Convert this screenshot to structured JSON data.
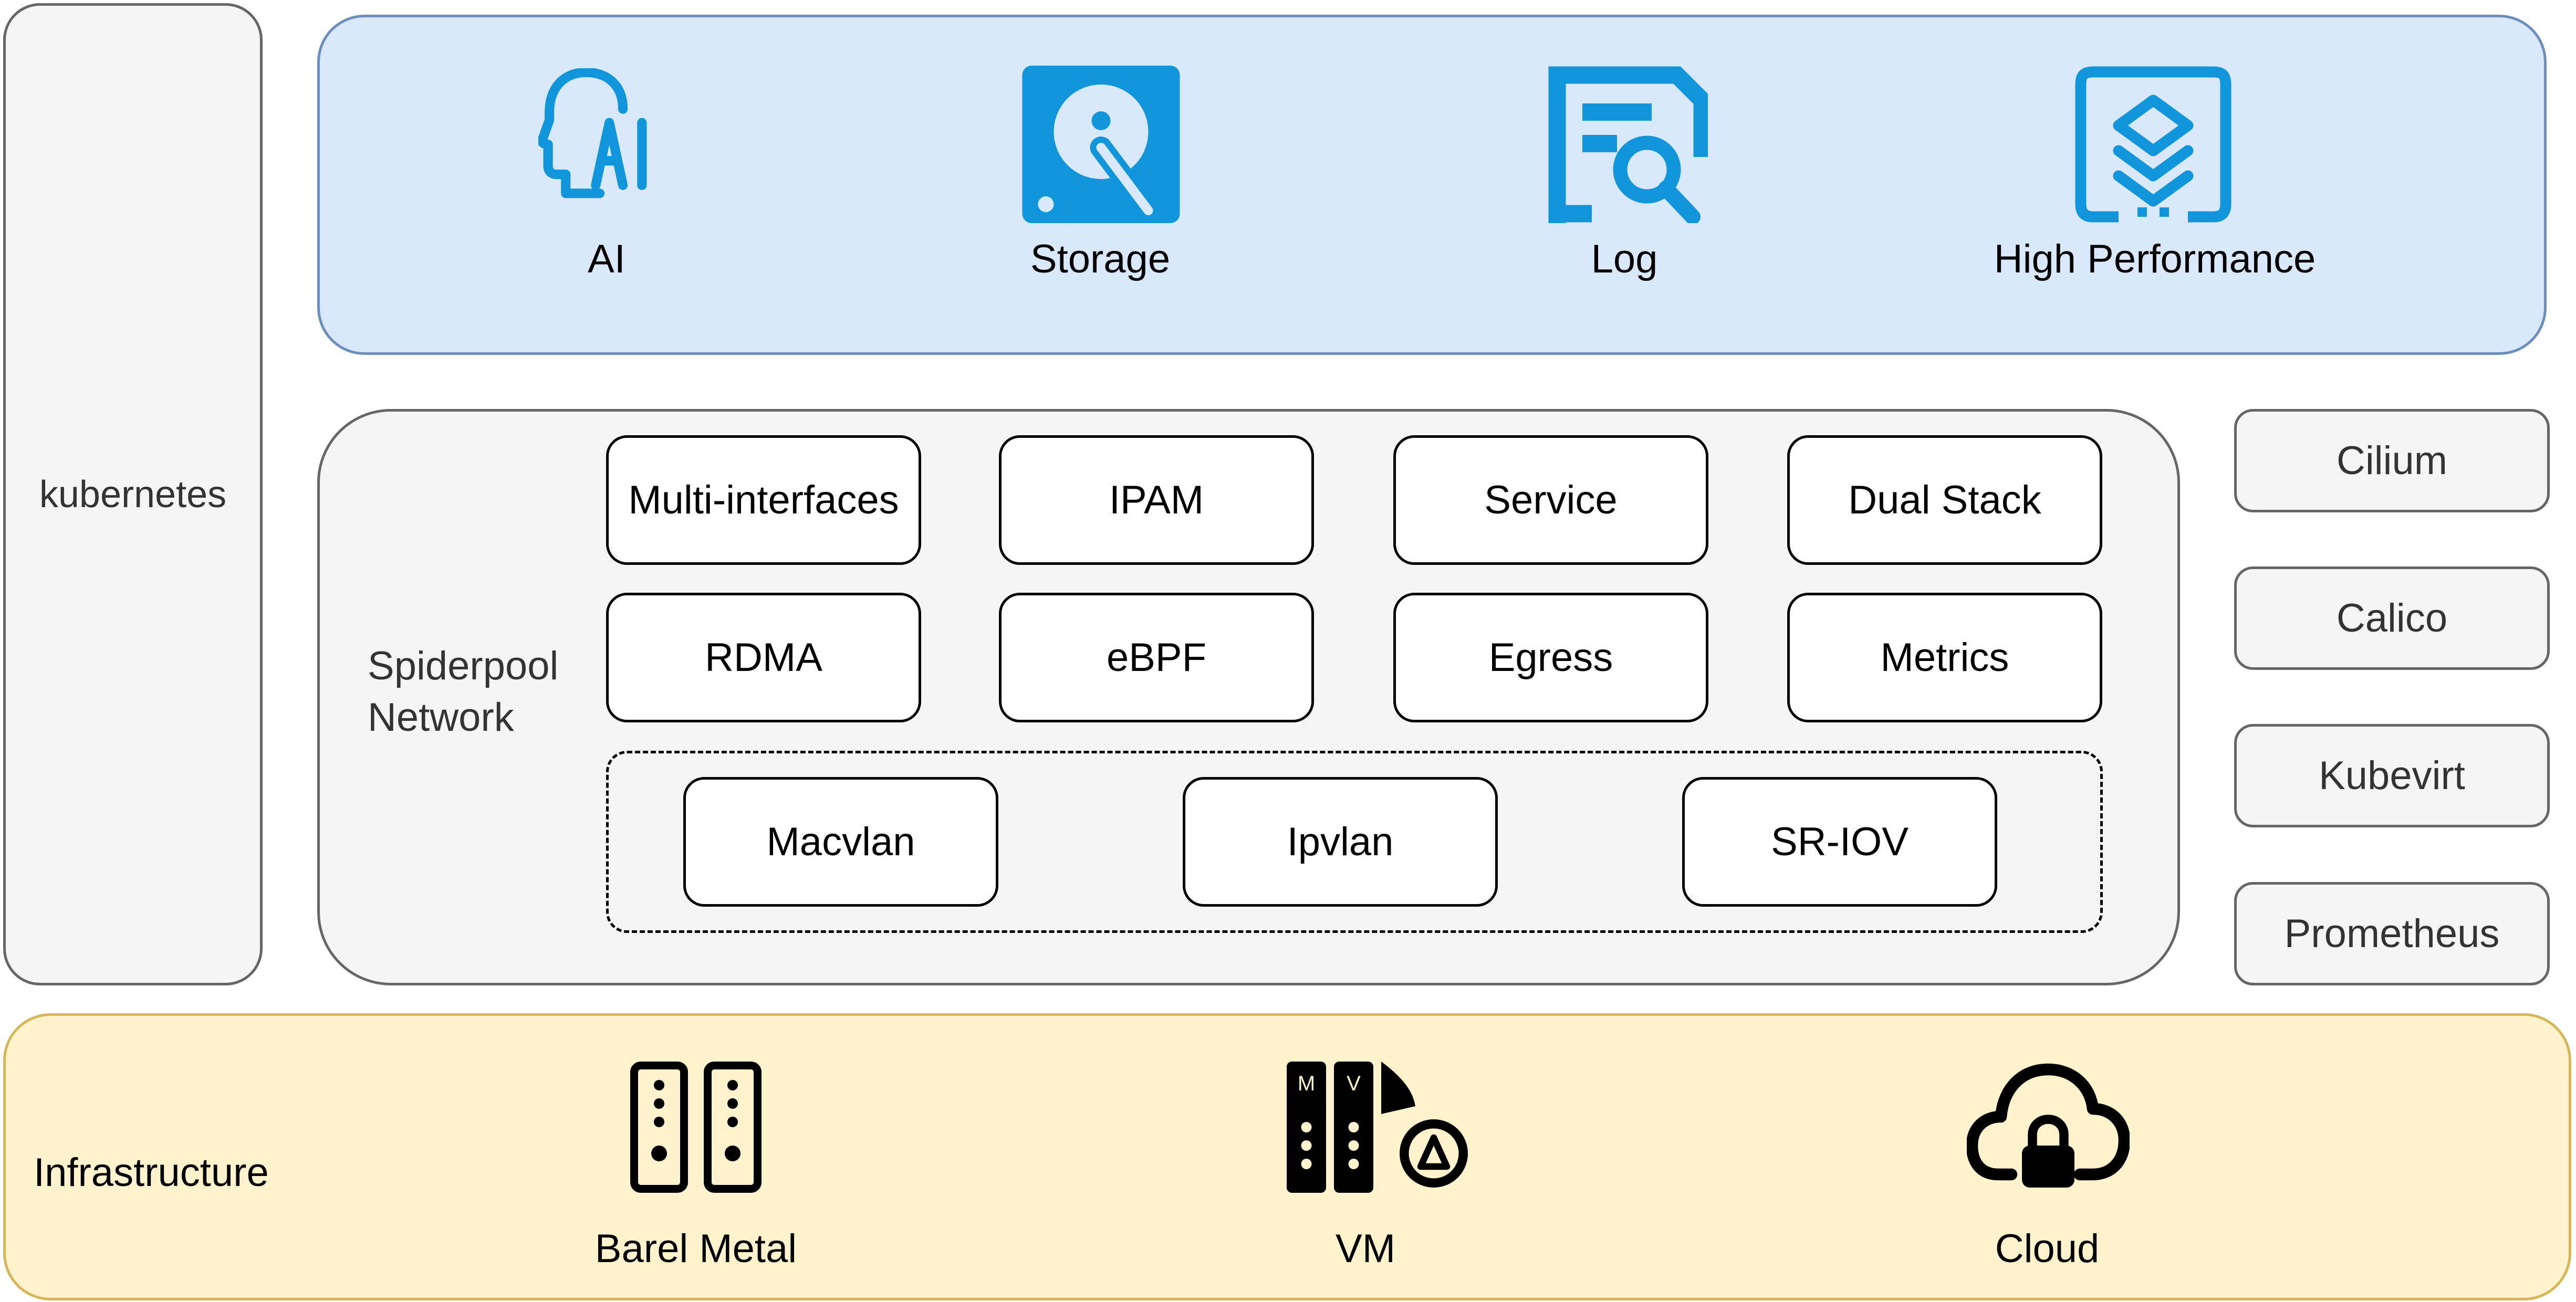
{
  "diagram": {
    "platform": {
      "label": "kubernetes"
    },
    "workloads": {
      "fill_color": "#dae8fc",
      "border_color": "#6c8ebf",
      "icon_color": "#1296db",
      "items": [
        {
          "label": "AI",
          "icon": "ai-head-icon"
        },
        {
          "label": "Storage",
          "icon": "hard-disk-icon"
        },
        {
          "label": "Log",
          "icon": "log-search-icon"
        },
        {
          "label": "High Performance",
          "icon": "layers-device-icon"
        }
      ]
    },
    "spiderpool": {
      "label_line1": "Spiderpool",
      "label_line2": "Network",
      "features_row1": [
        "Multi-interfaces",
        "IPAM",
        "Service",
        "Dual Stack"
      ],
      "features_row2": [
        "RDMA",
        "eBPF",
        "Egress",
        "Metrics"
      ],
      "cni_plugins": [
        "Macvlan",
        "Ipvlan",
        "SR-IOV"
      ]
    },
    "integrations": [
      "Cilium",
      "Calico",
      "Kubevirt",
      "Prometheus"
    ],
    "infrastructure": {
      "label": "Infrastructure",
      "fill_color": "#fff2cc",
      "border_color": "#d6b656",
      "items": [
        {
          "label": "Barel Metal",
          "icon": "bare-metal-server-icon"
        },
        {
          "label": "VM",
          "icon": "virtual-machine-icon",
          "badges": [
            "M",
            "V"
          ]
        },
        {
          "label": "Cloud",
          "icon": "cloud-lock-icon"
        }
      ]
    }
  }
}
